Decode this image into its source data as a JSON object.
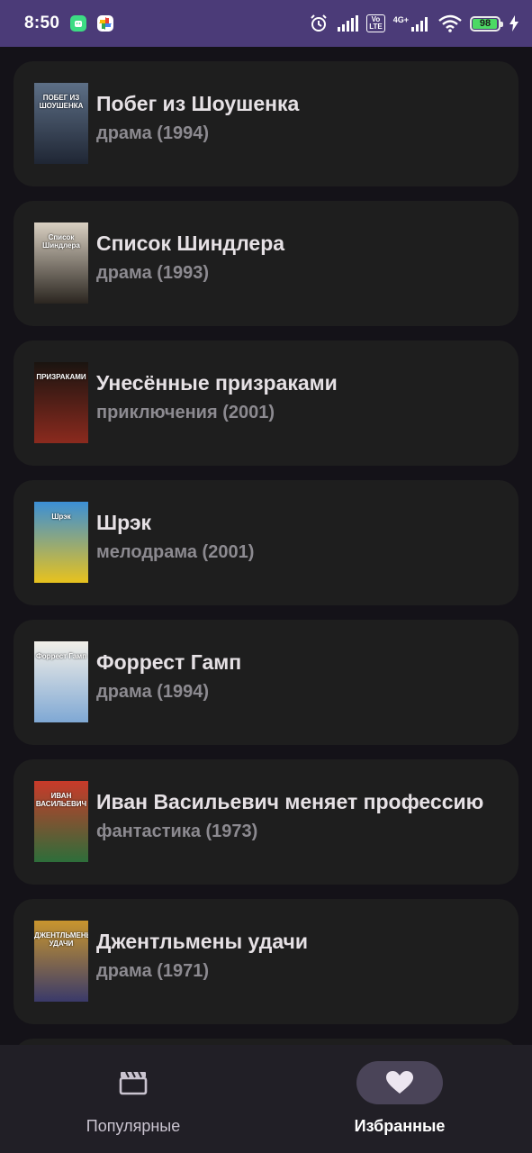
{
  "status_bar": {
    "time": "8:50",
    "lte_line1": "Vo",
    "lte_line2": "LTE",
    "network_label": "4G+",
    "battery_level": "98",
    "battery_fraction": 0.98
  },
  "movies": [
    {
      "title": "Побег из Шоушенка",
      "genre": "драма",
      "year": "(1994)",
      "subtitle": "драма (1994)",
      "poster_caption": "ПОБЕГ ИЗ ШОУШЕНКА",
      "poster_colors": [
        "#5d6f86",
        "#1f2634"
      ]
    },
    {
      "title": "Список Шиндлера",
      "genre": "драма",
      "year": "(1993)",
      "subtitle": "драма (1993)",
      "poster_caption": "Список Шиндлера",
      "poster_colors": [
        "#d9d0c2",
        "#2b2620"
      ]
    },
    {
      "title": "Унесённые призраками",
      "genre": "приключения",
      "year": "(2001)",
      "subtitle": "приключения (2001)",
      "poster_caption": "ПРИЗРАКАМИ",
      "poster_colors": [
        "#1a1410",
        "#8b2a1e"
      ]
    },
    {
      "title": "Шрэк",
      "genre": "мелодрама",
      "year": "(2001)",
      "subtitle": "мелодрама (2001)",
      "poster_caption": "Шрэк",
      "poster_colors": [
        "#3b8fd6",
        "#e8c21d"
      ]
    },
    {
      "title": "Форрест Гамп",
      "genre": "драма",
      "year": "(1994)",
      "subtitle": "драма (1994)",
      "poster_caption": "Форрест Гамп",
      "poster_colors": [
        "#f2efe8",
        "#7fa8d4"
      ]
    },
    {
      "title": "Иван Васильевич меняет профессию",
      "genre": "фантастика",
      "year": "(1973)",
      "subtitle": "фантастика (1973)",
      "poster_caption": "ИВАН ВАСИЛЬЕВИЧ",
      "poster_colors": [
        "#c93a2a",
        "#2d6e3a"
      ]
    },
    {
      "title": "Джентльмены удачи",
      "genre": "драма",
      "year": "(1971)",
      "subtitle": "драма (1971)",
      "poster_caption": "ДЖЕНТЛЬМЕНЫ УДАЧИ",
      "poster_colors": [
        "#c9962e",
        "#3a3a6a"
      ]
    }
  ],
  "bottom_nav": {
    "popular_label": "Популярные",
    "popular_icon": "movie-clapperboard-icon",
    "favorites_label": "Избранные",
    "favorites_icon": "heart-icon",
    "active_tab": "favorites"
  },
  "colors": {
    "status_bar_bg": "#4b3b78",
    "background": "#141218",
    "card_bg": "#1e1e1e",
    "title_text": "#e6e1e5",
    "subtitle_text": "#8c8a90",
    "nav_bg": "#211f26",
    "nav_active_pill": "#4a4458"
  }
}
